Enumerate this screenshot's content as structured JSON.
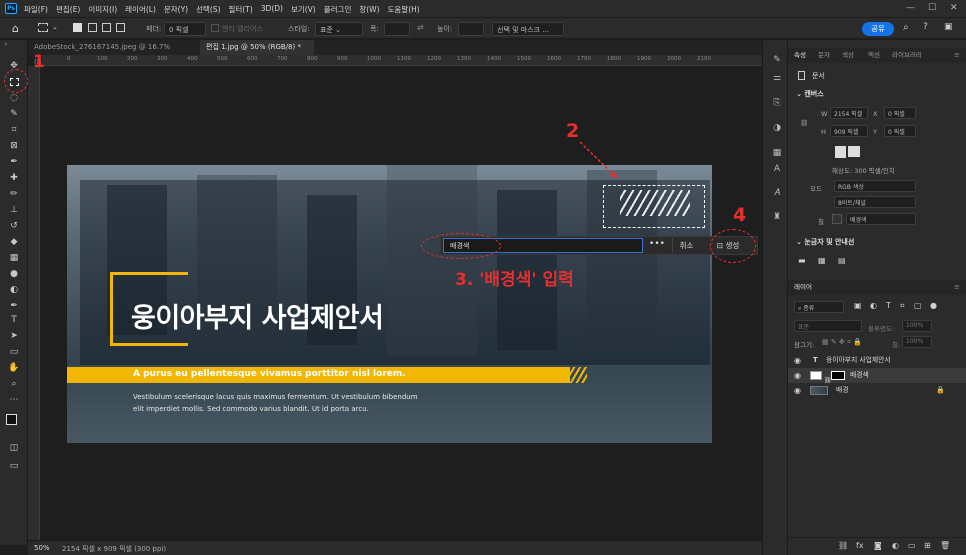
{
  "menubar": {
    "logo": "Ps",
    "items": [
      "파일(F)",
      "편집(E)",
      "이미지(I)",
      "레이어(L)",
      "문자(Y)",
      "선택(S)",
      "필터(T)",
      "3D(D)",
      "보기(V)",
      "플러그인",
      "창(W)",
      "도움말(H)"
    ]
  },
  "options": {
    "feather_label": "페더:",
    "feather_value": "0 픽셀",
    "antialias_label": "앤티 앨리어스",
    "style_label": "스타일:",
    "style_value": "표준",
    "width_label": "폭:",
    "height_label": "높이:",
    "select_mask_label": "선택 및 마스크 ...",
    "share_label": "공유"
  },
  "tabs": [
    {
      "label": "AdobeStock_276167145.jpeg @ 16.7% (RGB/8)",
      "close": "×"
    },
    {
      "label": "편집 1.jpg @ 50% (RGB/8) *",
      "close": "×"
    }
  ],
  "ruler_ticks": [
    "0",
    "100",
    "200",
    "300",
    "400",
    "500",
    "600",
    "700",
    "800",
    "900",
    "1000",
    "1100",
    "1200",
    "1300",
    "1400",
    "1500",
    "1600",
    "1700",
    "1800",
    "1900",
    "2000",
    "2100"
  ],
  "document": {
    "title": "웅이아부지 사업제안서",
    "subtitle": "A purus eu pellentesque vivamus porttitor nisl lorem.",
    "body_line1": "Vestibulum scelerisque lacus quis maximus fermentum. Ut vestibulum bibendum",
    "body_line2": "elit imperdiet mollis. Sed commodo varius blandit. Ut id porta arcu."
  },
  "taskbar": {
    "input_value": "배경색",
    "more": "•••",
    "cancel": "취소",
    "generate": "생성"
  },
  "annotations": {
    "n1": "1",
    "n2": "2",
    "n3": "3. '배경색' 입력",
    "n4": "4"
  },
  "status": {
    "zoom": "50%",
    "info": "2154 픽셀 x 909 픽셀 (300 ppi)"
  },
  "panel": {
    "tabs": [
      "속성",
      "문자",
      "색상",
      "액션",
      "라이브러리"
    ],
    "doc_label": "문서",
    "canvas_head": "캔버스",
    "w_label": "W",
    "w_value": "2154 픽셀",
    "x_label": "X",
    "x_value": "0 픽셀",
    "h_label": "H",
    "h_value": "909 픽셀",
    "y_label": "Y",
    "y_value": "0 픽셀",
    "resolution": "해상도: 300 픽셀/인치",
    "mode_label": "모드",
    "mode_value": "RGB 색상",
    "depth_value": "8비트/채널",
    "fill_label": "칠",
    "fill_value": "배경색",
    "rulers_head": "눈금자 및 안내선",
    "layers_tab": "레이어",
    "kind_label": "종류",
    "blend_value": "표준",
    "opacity_label": "불투명도:",
    "opacity_value": "100%",
    "lock_label": "잠그기:",
    "fill2_label": "칠:",
    "fill2_value": "100%",
    "layers": [
      {
        "name": "웅이아부지 사업제안서",
        "type": "T"
      },
      {
        "name": "배경색",
        "type": "fill"
      },
      {
        "name": "배경",
        "type": "image"
      }
    ]
  },
  "colors": {
    "accent": "#f2b705",
    "annotation": "#e53030",
    "share": "#1473e6"
  }
}
